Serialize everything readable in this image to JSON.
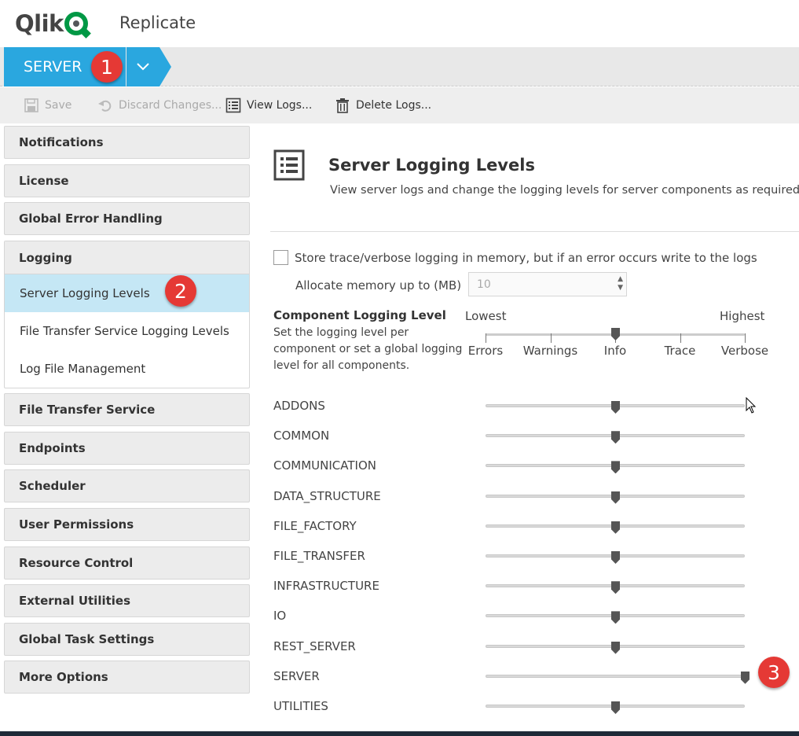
{
  "header": {
    "logo_text": "Qlik",
    "app_name": "Replicate"
  },
  "breadcrumb": {
    "label": "SERVER",
    "badge": "1"
  },
  "toolbar": {
    "save": "Save",
    "discard": "Discard Changes...",
    "view_logs": "View Logs...",
    "delete_logs": "Delete Logs..."
  },
  "sidebar": {
    "notifications": "Notifications",
    "license": "License",
    "global_error_handling": "Global Error Handling",
    "logging": {
      "label": "Logging",
      "items": [
        "Server Logging Levels",
        "File Transfer Service Logging Levels",
        "Log File Management"
      ],
      "active_badge": "2"
    },
    "file_transfer_service": "File Transfer Service",
    "endpoints": "Endpoints",
    "scheduler": "Scheduler",
    "user_permissions": "User Permissions",
    "resource_control": "Resource Control",
    "external_utilities": "External Utilities",
    "global_task_settings": "Global Task Settings",
    "more_options": "More Options"
  },
  "main": {
    "title": "Server Logging Levels",
    "description": "View server logs and change the logging levels for server components as required.",
    "store_trace_label": "Store trace/verbose logging in memory, but if an error occurs write to the logs",
    "store_trace_checked": false,
    "memory_label": "Allocate memory up to (MB)",
    "memory_value": "10",
    "component_title": "Component Logging Level",
    "component_desc": "Set the logging level per component or set a global logging level for all components.",
    "scale": {
      "lowest": "Lowest",
      "highest": "Highest",
      "levels": [
        "Errors",
        "Warnings",
        "Info",
        "Trace",
        "Verbose"
      ],
      "global_level": "Info"
    },
    "components": [
      {
        "name": "ADDONS",
        "level": "Info"
      },
      {
        "name": "COMMON",
        "level": "Info"
      },
      {
        "name": "COMMUNICATION",
        "level": "Info"
      },
      {
        "name": "DATA_STRUCTURE",
        "level": "Info"
      },
      {
        "name": "FILE_FACTORY",
        "level": "Info"
      },
      {
        "name": "FILE_TRANSFER",
        "level": "Info"
      },
      {
        "name": "INFRASTRUCTURE",
        "level": "Info"
      },
      {
        "name": "IO",
        "level": "Info"
      },
      {
        "name": "REST_SERVER",
        "level": "Info"
      },
      {
        "name": "SERVER",
        "level": "Verbose"
      },
      {
        "name": "UTILITIES",
        "level": "Info"
      }
    ],
    "server_badge": "3"
  },
  "colors": {
    "accent": "#2aa7df",
    "active_item": "#c5e7f5",
    "badge": "#e53935",
    "logo_green": "#009845"
  }
}
